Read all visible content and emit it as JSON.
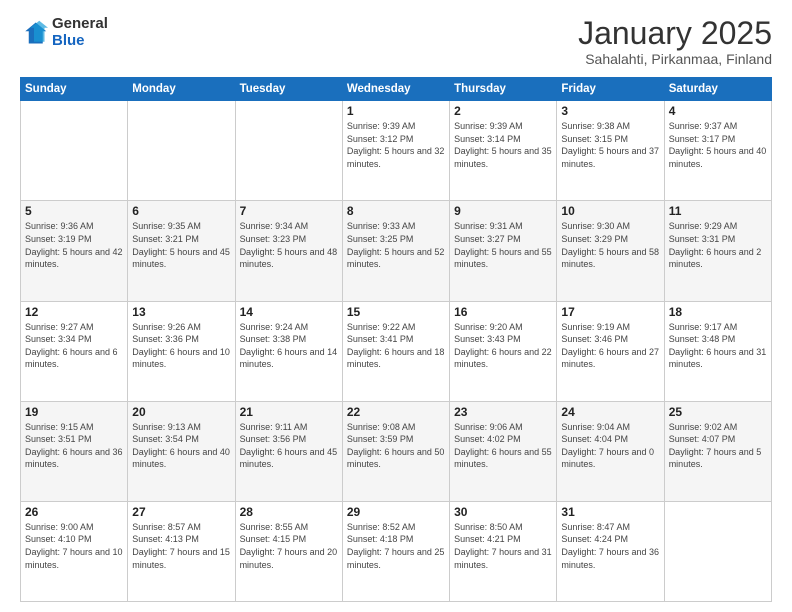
{
  "header": {
    "logo_general": "General",
    "logo_blue": "Blue",
    "title": "January 2025",
    "location": "Sahalahti, Pirkanmaa, Finland"
  },
  "weekdays": [
    "Sunday",
    "Monday",
    "Tuesday",
    "Wednesday",
    "Thursday",
    "Friday",
    "Saturday"
  ],
  "weeks": [
    [
      {
        "day": "",
        "info": ""
      },
      {
        "day": "",
        "info": ""
      },
      {
        "day": "",
        "info": ""
      },
      {
        "day": "1",
        "info": "Sunrise: 9:39 AM\nSunset: 3:12 PM\nDaylight: 5 hours and 32 minutes."
      },
      {
        "day": "2",
        "info": "Sunrise: 9:39 AM\nSunset: 3:14 PM\nDaylight: 5 hours and 35 minutes."
      },
      {
        "day": "3",
        "info": "Sunrise: 9:38 AM\nSunset: 3:15 PM\nDaylight: 5 hours and 37 minutes."
      },
      {
        "day": "4",
        "info": "Sunrise: 9:37 AM\nSunset: 3:17 PM\nDaylight: 5 hours and 40 minutes."
      }
    ],
    [
      {
        "day": "5",
        "info": "Sunrise: 9:36 AM\nSunset: 3:19 PM\nDaylight: 5 hours and 42 minutes."
      },
      {
        "day": "6",
        "info": "Sunrise: 9:35 AM\nSunset: 3:21 PM\nDaylight: 5 hours and 45 minutes."
      },
      {
        "day": "7",
        "info": "Sunrise: 9:34 AM\nSunset: 3:23 PM\nDaylight: 5 hours and 48 minutes."
      },
      {
        "day": "8",
        "info": "Sunrise: 9:33 AM\nSunset: 3:25 PM\nDaylight: 5 hours and 52 minutes."
      },
      {
        "day": "9",
        "info": "Sunrise: 9:31 AM\nSunset: 3:27 PM\nDaylight: 5 hours and 55 minutes."
      },
      {
        "day": "10",
        "info": "Sunrise: 9:30 AM\nSunset: 3:29 PM\nDaylight: 5 hours and 58 minutes."
      },
      {
        "day": "11",
        "info": "Sunrise: 9:29 AM\nSunset: 3:31 PM\nDaylight: 6 hours and 2 minutes."
      }
    ],
    [
      {
        "day": "12",
        "info": "Sunrise: 9:27 AM\nSunset: 3:34 PM\nDaylight: 6 hours and 6 minutes."
      },
      {
        "day": "13",
        "info": "Sunrise: 9:26 AM\nSunset: 3:36 PM\nDaylight: 6 hours and 10 minutes."
      },
      {
        "day": "14",
        "info": "Sunrise: 9:24 AM\nSunset: 3:38 PM\nDaylight: 6 hours and 14 minutes."
      },
      {
        "day": "15",
        "info": "Sunrise: 9:22 AM\nSunset: 3:41 PM\nDaylight: 6 hours and 18 minutes."
      },
      {
        "day": "16",
        "info": "Sunrise: 9:20 AM\nSunset: 3:43 PM\nDaylight: 6 hours and 22 minutes."
      },
      {
        "day": "17",
        "info": "Sunrise: 9:19 AM\nSunset: 3:46 PM\nDaylight: 6 hours and 27 minutes."
      },
      {
        "day": "18",
        "info": "Sunrise: 9:17 AM\nSunset: 3:48 PM\nDaylight: 6 hours and 31 minutes."
      }
    ],
    [
      {
        "day": "19",
        "info": "Sunrise: 9:15 AM\nSunset: 3:51 PM\nDaylight: 6 hours and 36 minutes."
      },
      {
        "day": "20",
        "info": "Sunrise: 9:13 AM\nSunset: 3:54 PM\nDaylight: 6 hours and 40 minutes."
      },
      {
        "day": "21",
        "info": "Sunrise: 9:11 AM\nSunset: 3:56 PM\nDaylight: 6 hours and 45 minutes."
      },
      {
        "day": "22",
        "info": "Sunrise: 9:08 AM\nSunset: 3:59 PM\nDaylight: 6 hours and 50 minutes."
      },
      {
        "day": "23",
        "info": "Sunrise: 9:06 AM\nSunset: 4:02 PM\nDaylight: 6 hours and 55 minutes."
      },
      {
        "day": "24",
        "info": "Sunrise: 9:04 AM\nSunset: 4:04 PM\nDaylight: 7 hours and 0 minutes."
      },
      {
        "day": "25",
        "info": "Sunrise: 9:02 AM\nSunset: 4:07 PM\nDaylight: 7 hours and 5 minutes."
      }
    ],
    [
      {
        "day": "26",
        "info": "Sunrise: 9:00 AM\nSunset: 4:10 PM\nDaylight: 7 hours and 10 minutes."
      },
      {
        "day": "27",
        "info": "Sunrise: 8:57 AM\nSunset: 4:13 PM\nDaylight: 7 hours and 15 minutes."
      },
      {
        "day": "28",
        "info": "Sunrise: 8:55 AM\nSunset: 4:15 PM\nDaylight: 7 hours and 20 minutes."
      },
      {
        "day": "29",
        "info": "Sunrise: 8:52 AM\nSunset: 4:18 PM\nDaylight: 7 hours and 25 minutes."
      },
      {
        "day": "30",
        "info": "Sunrise: 8:50 AM\nSunset: 4:21 PM\nDaylight: 7 hours and 31 minutes."
      },
      {
        "day": "31",
        "info": "Sunrise: 8:47 AM\nSunset: 4:24 PM\nDaylight: 7 hours and 36 minutes."
      },
      {
        "day": "",
        "info": ""
      }
    ]
  ]
}
